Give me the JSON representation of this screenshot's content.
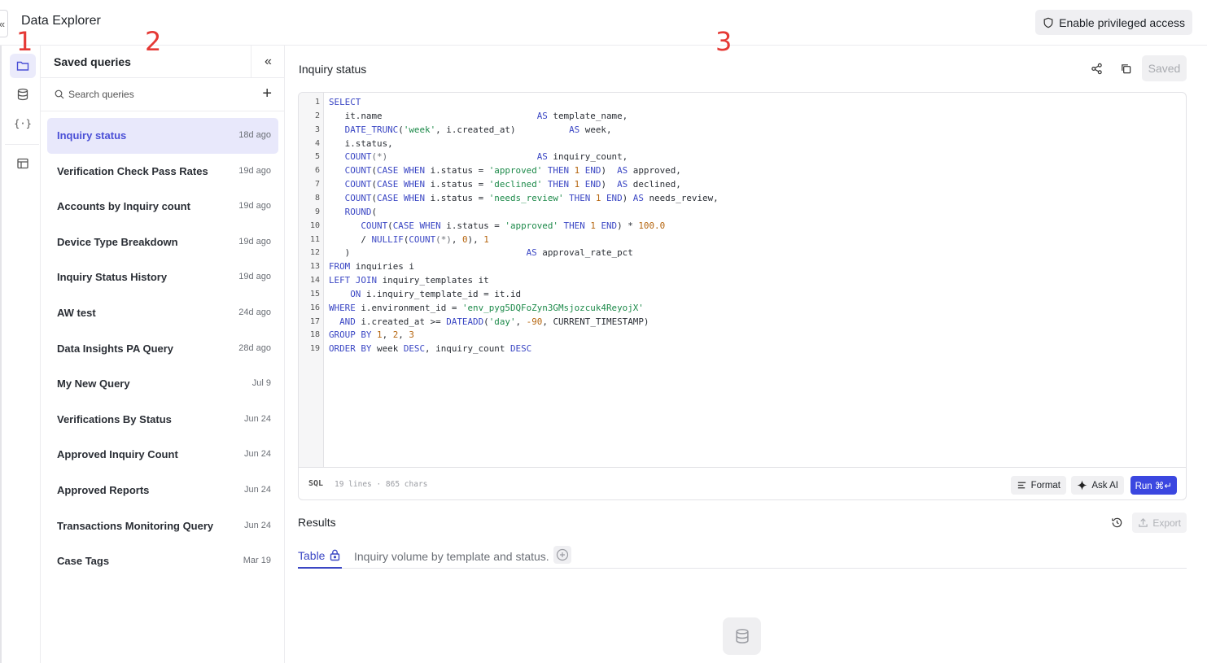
{
  "app": {
    "title": "Data Explorer",
    "privileged_label": "Enable privileged access"
  },
  "annotations": [
    "1",
    "2",
    "3"
  ],
  "rail": {
    "icons": [
      "folder-icon",
      "database-icon",
      "json-icon",
      "layout-icon"
    ],
    "json_glyph": "{·}"
  },
  "saved_panel": {
    "title": "Saved queries",
    "collapse_glyph": "«",
    "search_placeholder": "Search queries",
    "add_glyph": "+",
    "queries": [
      {
        "name": "Inquiry status",
        "date": "18d ago",
        "active": true
      },
      {
        "name": "Verification Check Pass Rates",
        "date": "19d ago"
      },
      {
        "name": "Accounts by Inquiry count",
        "date": "19d ago"
      },
      {
        "name": "Device Type Breakdown",
        "date": "19d ago"
      },
      {
        "name": "Inquiry Status History",
        "date": "19d ago"
      },
      {
        "name": "AW test",
        "date": "24d ago"
      },
      {
        "name": "Data Insights PA Query",
        "date": "28d ago"
      },
      {
        "name": "My New Query",
        "date": "Jul 9"
      },
      {
        "name": "Verifications By Status",
        "date": "Jun 24"
      },
      {
        "name": "Approved Inquiry Count",
        "date": "Jun 24"
      },
      {
        "name": "Approved Reports",
        "date": "Jun 24"
      },
      {
        "name": "Transactions Monitoring Query",
        "date": "Jun 24"
      },
      {
        "name": "Case Tags",
        "date": "Mar 19"
      }
    ]
  },
  "editor": {
    "query_title": "Inquiry status",
    "saved_label": "Saved",
    "language": "SQL",
    "stats": "19 lines · 865 chars",
    "format_label": "Format",
    "ask_ai_label": "Ask AI",
    "run_label": "Run ⌘↵",
    "line_numbers": [
      "1",
      "2",
      "3",
      "4",
      "5",
      "6",
      "7",
      "8",
      "9",
      "10",
      "11",
      "12",
      "13",
      "14",
      "15",
      "16",
      "17",
      "18",
      "19"
    ],
    "code_lines": [
      [
        [
          "kw",
          "SELECT"
        ]
      ],
      [
        [
          "",
          "   it.name                             "
        ],
        [
          "kw",
          "AS"
        ],
        [
          "",
          " template_name,"
        ]
      ],
      [
        [
          "",
          "   "
        ],
        [
          "fn",
          "DATE_TRUNC"
        ],
        [
          "",
          "("
        ],
        [
          "str",
          "'week'"
        ],
        [
          "",
          ", i.created_at)          "
        ],
        [
          "kw",
          "AS"
        ],
        [
          "",
          " week,"
        ]
      ],
      [
        [
          "",
          "   i.status,"
        ]
      ],
      [
        [
          "",
          "   "
        ],
        [
          "fn",
          "COUNT"
        ],
        [
          "op",
          "(*)"
        ],
        [
          "",
          "                            "
        ],
        [
          "kw",
          "AS"
        ],
        [
          "",
          " inquiry_count,"
        ]
      ],
      [
        [
          "",
          "   "
        ],
        [
          "fn",
          "COUNT"
        ],
        [
          "",
          "("
        ],
        [
          "kw",
          "CASE WHEN"
        ],
        [
          "",
          " i.status = "
        ],
        [
          "str",
          "'approved'"
        ],
        [
          "",
          ""
        ],
        [
          "kw",
          " THEN "
        ],
        [
          "num",
          "1"
        ],
        [
          "kw",
          " END"
        ],
        [
          "",
          ")  "
        ],
        [
          "kw",
          "AS"
        ],
        [
          "",
          " approved,"
        ]
      ],
      [
        [
          "",
          "   "
        ],
        [
          "fn",
          "COUNT"
        ],
        [
          "",
          "("
        ],
        [
          "kw",
          "CASE WHEN"
        ],
        [
          "",
          " i.status = "
        ],
        [
          "str",
          "'declined'"
        ],
        [
          "kw",
          " THEN "
        ],
        [
          "num",
          "1"
        ],
        [
          "kw",
          " END"
        ],
        [
          "",
          ")  "
        ],
        [
          "kw",
          "AS"
        ],
        [
          "",
          " declined,"
        ]
      ],
      [
        [
          "",
          "   "
        ],
        [
          "fn",
          "COUNT"
        ],
        [
          "",
          "("
        ],
        [
          "kw",
          "CASE WHEN"
        ],
        [
          "",
          " i.status = "
        ],
        [
          "str",
          "'needs_review'"
        ],
        [
          "kw",
          " THEN "
        ],
        [
          "num",
          "1"
        ],
        [
          "kw",
          " END"
        ],
        [
          "",
          ") "
        ],
        [
          "kw",
          "AS"
        ],
        [
          "",
          " needs_review,"
        ]
      ],
      [
        [
          "",
          "   "
        ],
        [
          "fn",
          "ROUND"
        ],
        [
          "",
          "("
        ]
      ],
      [
        [
          "",
          "      "
        ],
        [
          "fn",
          "COUNT"
        ],
        [
          "",
          "("
        ],
        [
          "kw",
          "CASE WHEN"
        ],
        [
          "",
          " i.status = "
        ],
        [
          "str",
          "'approved'"
        ],
        [
          "kw",
          " THEN "
        ],
        [
          "num",
          "1"
        ],
        [
          "kw",
          " END"
        ],
        [
          "",
          ") * "
        ],
        [
          "num",
          "100.0"
        ]
      ],
      [
        [
          "",
          "      / "
        ],
        [
          "fn",
          "NULLIF"
        ],
        [
          "",
          "("
        ],
        [
          "fn",
          "COUNT"
        ],
        [
          "op",
          "(*)"
        ],
        [
          "",
          ", "
        ],
        [
          "num",
          "0"
        ],
        [
          "",
          "), "
        ],
        [
          "num",
          "1"
        ]
      ],
      [
        [
          "",
          "   )                                 "
        ],
        [
          "kw",
          "AS"
        ],
        [
          "",
          " approval_rate_pct"
        ]
      ],
      [
        [
          "kw",
          "FROM"
        ],
        [
          "",
          " inquiries i"
        ]
      ],
      [
        [
          "kw",
          "LEFT JOIN"
        ],
        [
          "",
          " inquiry_templates it"
        ]
      ],
      [
        [
          "",
          "    "
        ],
        [
          "kw",
          "ON"
        ],
        [
          "",
          " i.inquiry_template_id = it.id"
        ]
      ],
      [
        [
          "kw",
          "WHERE"
        ],
        [
          "",
          " i.environment_id = "
        ],
        [
          "str",
          "'env_pyg5DQFoZyn3GMsjozcuk4ReyojX'"
        ]
      ],
      [
        [
          "",
          "  "
        ],
        [
          "kw",
          "AND"
        ],
        [
          "",
          " i.created_at >= "
        ],
        [
          "fn",
          "DATEADD"
        ],
        [
          "",
          "("
        ],
        [
          "str",
          "'day'"
        ],
        [
          "",
          ", "
        ],
        [
          "num",
          "-90"
        ],
        [
          "",
          ", CURRENT_TIMESTAMP)"
        ]
      ],
      [
        [
          "kw",
          "GROUP BY"
        ],
        [
          "",
          " "
        ],
        [
          "num",
          "1"
        ],
        [
          "",
          ", "
        ],
        [
          "num",
          "2"
        ],
        [
          "",
          ", "
        ],
        [
          "num",
          "3"
        ]
      ],
      [
        [
          "kw",
          "ORDER BY"
        ],
        [
          "",
          " week "
        ],
        [
          "kw",
          "DESC"
        ],
        [
          "",
          ", inquiry_count "
        ],
        [
          "kw",
          "DESC"
        ]
      ]
    ]
  },
  "results": {
    "title": "Results",
    "export_label": "Export",
    "tab_table": "Table",
    "tab_description": "Inquiry volume by template and status."
  }
}
